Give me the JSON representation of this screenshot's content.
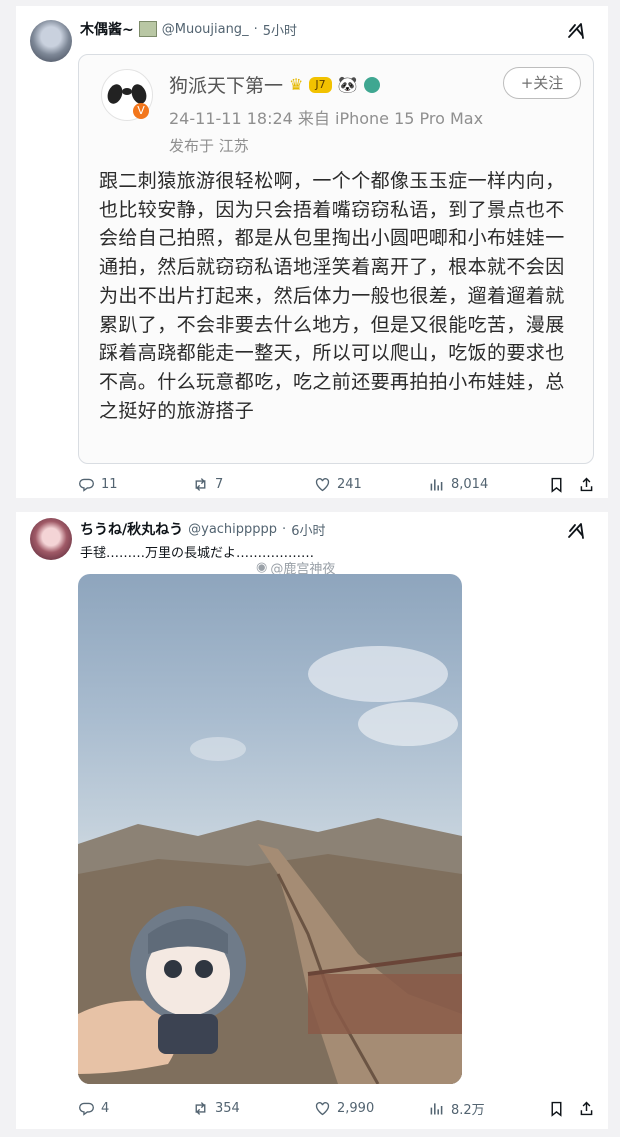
{
  "post1": {
    "user_name": "木偶酱~",
    "handle": "@Muoujiang_",
    "separator": "·",
    "time": "5小时",
    "quote": {
      "name": "狗派天下第一",
      "badge": "J7",
      "follow": "+关注",
      "meta": "24-11-11 18:24  来自 iPhone 15 Pro Max",
      "location": "发布于 江苏",
      "body": "跟二刺猿旅游很轻松啊，一个个都像玉玉症一样内向，也比较安静，因为只会捂着嘴窃窃私语，到了景点也不会给自己拍照，都是从包里掏出小圆吧唧和小布娃娃一通拍，然后就窃窃私语地淫笑着离开了，根本就不会因为出不出片打起来，然后体力一般也很差，遛着遛着就累趴了，不会非要去什么地方，但是又很能吃苦，漫展踩着高跷都能走一整天，所以可以爬山，吃饭的要求也不高。什么玩意都吃，吃之前还要再拍拍小布娃娃，总之挺好的旅游搭子"
    },
    "stats": {
      "replies": "11",
      "reposts": "7",
      "likes": "241",
      "views": "8,014"
    }
  },
  "post2": {
    "user_name": "ちうね/秋丸ねう",
    "handle": "@yachippppp",
    "separator": "·",
    "time": "6小时",
    "text": "手毬………万里の長城だよ………………",
    "watermark": "@鹿宫神夜",
    "stats": {
      "replies": "4",
      "reposts": "354",
      "likes": "2,990",
      "views": "8.2万"
    }
  },
  "icons": {
    "grok": "grok-icon",
    "reply": "reply-icon",
    "repost": "repost-icon",
    "like": "heart-icon",
    "views": "views-icon",
    "bookmark": "bookmark-icon",
    "share": "share-icon"
  }
}
